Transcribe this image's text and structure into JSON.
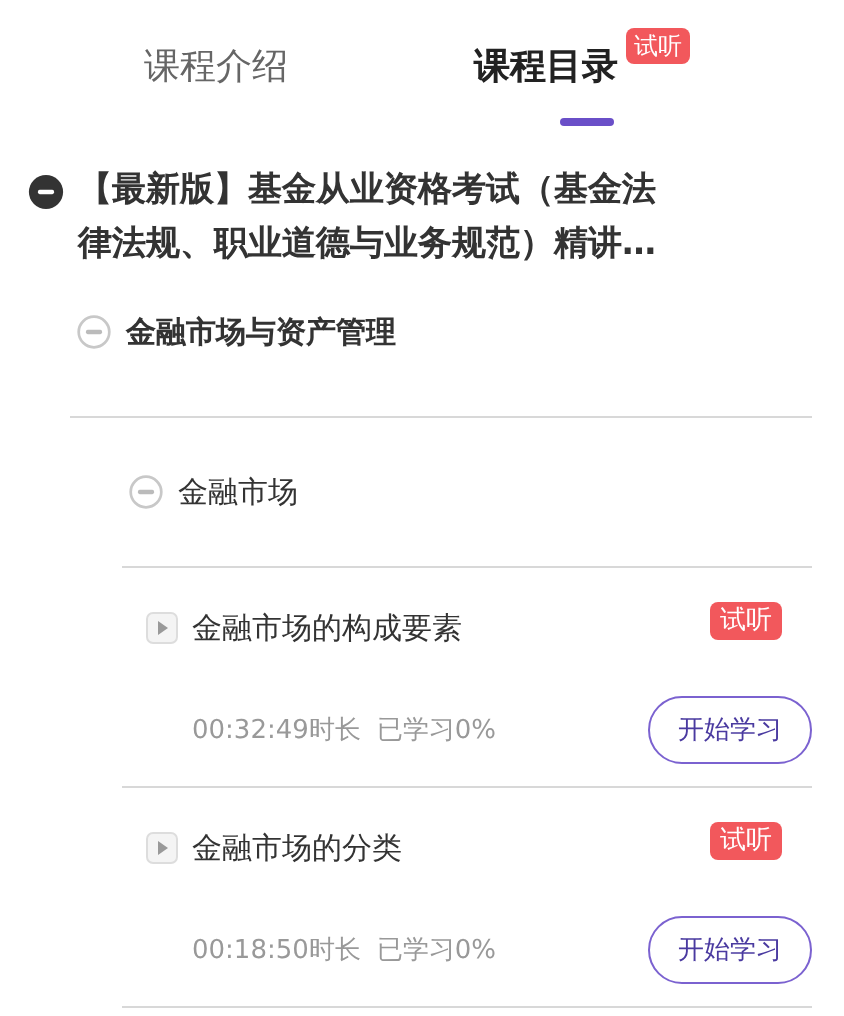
{
  "tabs": [
    {
      "label": "课程介绍",
      "selected": false
    },
    {
      "label": "课程目录",
      "selected": true,
      "badge": "试听"
    }
  ],
  "course": {
    "title": "【最新版】基金从业资格考试（基金法律法规、职业道德与业务规范）精讲…",
    "expanded": true,
    "children": [
      {
        "title": "金融市场与资产管理",
        "expanded": true,
        "children": [
          {
            "title": "金融市场",
            "expanded": true,
            "children": [
              {
                "title": "金融市场的构成要素",
                "badge": "试听",
                "duration": "00:32:49时长",
                "progress": "已学习0%",
                "button": "开始学习"
              },
              {
                "title": "金融市场的分类",
                "badge": "试听",
                "duration": "00:18:50时长",
                "progress": "已学习0%",
                "button": "开始学习"
              }
            ]
          }
        ]
      }
    ]
  }
}
